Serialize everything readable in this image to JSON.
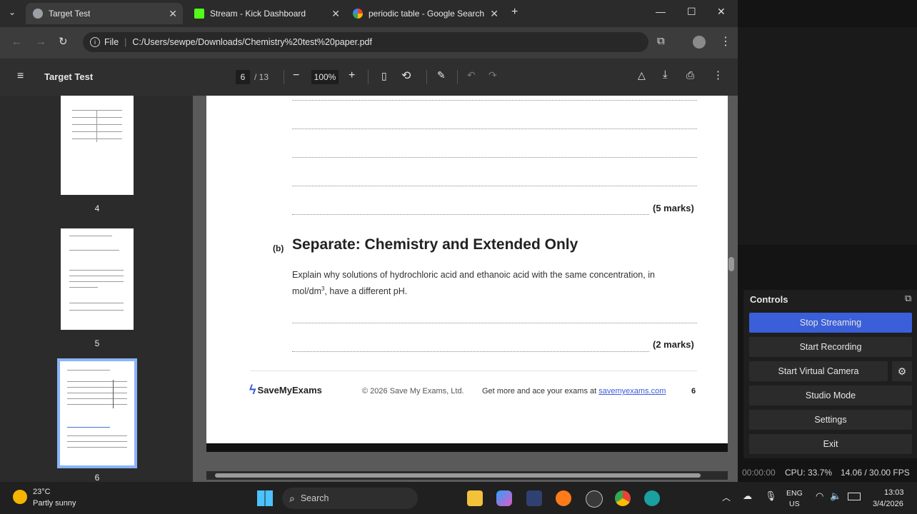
{
  "browser": {
    "tabs": [
      {
        "label": "Target Test",
        "active": true
      },
      {
        "label": "Stream - Kick Dashboard",
        "active": false
      },
      {
        "label": "periodic table - Google Search",
        "active": false
      }
    ],
    "address": {
      "scheme_label": "File",
      "url": "C:/Users/sewpe/Downloads/Chemistry%20test%20paper.pdf"
    }
  },
  "pdf_toolbar": {
    "title": "Target Test",
    "page_current": "6",
    "page_total": "/ 13",
    "zoom": "100%"
  },
  "thumbnails": [
    {
      "label": "4"
    },
    {
      "label": "5"
    },
    {
      "label": "6",
      "selected": true
    }
  ],
  "document": {
    "marks_a": "(5 marks)",
    "part_label": "(b)",
    "heading": "Separate: Chemistry and Extended Only",
    "question_line1": "Explain why solutions of hydrochloric acid and ethanoic acid with the same concentration, in",
    "question_line2_pre": "mol/dm",
    "question_sup": "3",
    "question_line2_post": ", have a different pH.",
    "marks_b": "(2 marks)",
    "footer_brand": "SaveMyExams",
    "footer_copyright": "© 2026 Save My Exams, Ltd.",
    "footer_cta": "Get more and ace your exams at",
    "footer_link": "savemyexams.com",
    "footer_page": "6"
  },
  "obs": {
    "controls_title": "Controls",
    "buttons": [
      "Stop Streaming",
      "Start Recording",
      "Start Virtual Camera",
      "Studio Mode",
      "Settings",
      "Exit"
    ],
    "status": {
      "time": "00:00:00",
      "cpu": "CPU: 33.7%",
      "fps": "14.06 / 30.00 FPS"
    }
  },
  "taskbar": {
    "weather_temp": "23°C",
    "weather_desc": "Partly sunny",
    "search_label": "Search",
    "lang1": "ENG",
    "lang2": "US",
    "time": "13:03",
    "date": "3/4/2026"
  },
  "colors": {
    "obs_accent": "#3a5fd8",
    "link": "#3b5bdb"
  }
}
